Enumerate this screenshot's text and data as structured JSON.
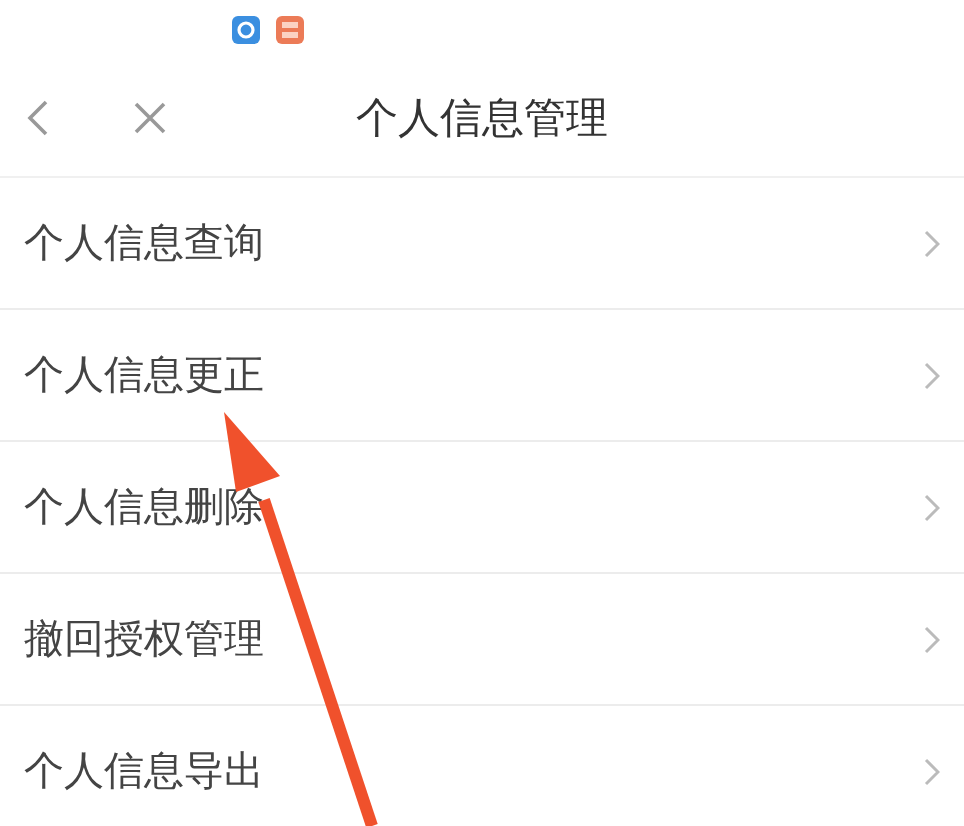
{
  "nav": {
    "title": "个人信息管理"
  },
  "items": [
    {
      "label": "个人信息查询"
    },
    {
      "label": "个人信息更正"
    },
    {
      "label": "个人信息删除"
    },
    {
      "label": "撤回授权管理"
    },
    {
      "label": "个人信息导出"
    }
  ]
}
